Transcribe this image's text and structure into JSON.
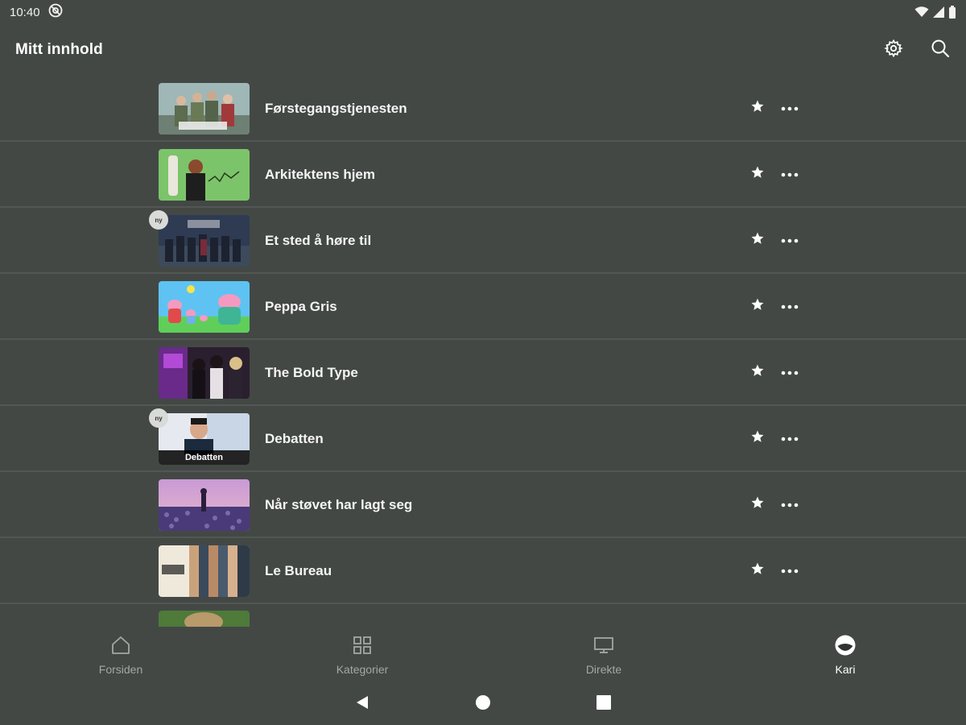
{
  "status_bar": {
    "time": "10:40",
    "icons": [
      "at-sign-icon",
      "wifi-icon",
      "signal-icon",
      "battery-icon"
    ]
  },
  "app_bar": {
    "title": "Mitt innhold",
    "actions": [
      "gear-icon",
      "search-icon"
    ]
  },
  "list": {
    "items": [
      {
        "title": "Førstegangstjenesten",
        "badge": "",
        "caption": ""
      },
      {
        "title": "Arkitektens hjem",
        "badge": "",
        "caption": ""
      },
      {
        "title": "Et sted å høre til",
        "badge": "ny",
        "caption": ""
      },
      {
        "title": "Peppa Gris",
        "badge": "",
        "caption": ""
      },
      {
        "title": "The Bold Type",
        "badge": "",
        "caption": ""
      },
      {
        "title": "Debatten",
        "badge": "ny",
        "caption": "Debatten"
      },
      {
        "title": "Når støvet har lagt seg",
        "badge": "",
        "caption": ""
      },
      {
        "title": "Le Bureau",
        "badge": "",
        "caption": ""
      }
    ]
  },
  "bottom_nav": {
    "items": [
      {
        "label": "Forsiden",
        "icon": "home-icon",
        "active": false
      },
      {
        "label": "Kategorier",
        "icon": "grid-icon",
        "active": false
      },
      {
        "label": "Direkte",
        "icon": "tv-icon",
        "active": false
      },
      {
        "label": "Kari",
        "icon": "profile-avatar-icon",
        "active": true
      }
    ]
  },
  "system_nav": [
    "back-icon",
    "home-circle-icon",
    "recents-icon"
  ],
  "colors": {
    "background": "#434845",
    "divider": "#525755",
    "text": "#ffffff",
    "muted_text": "#a3a7a5"
  }
}
